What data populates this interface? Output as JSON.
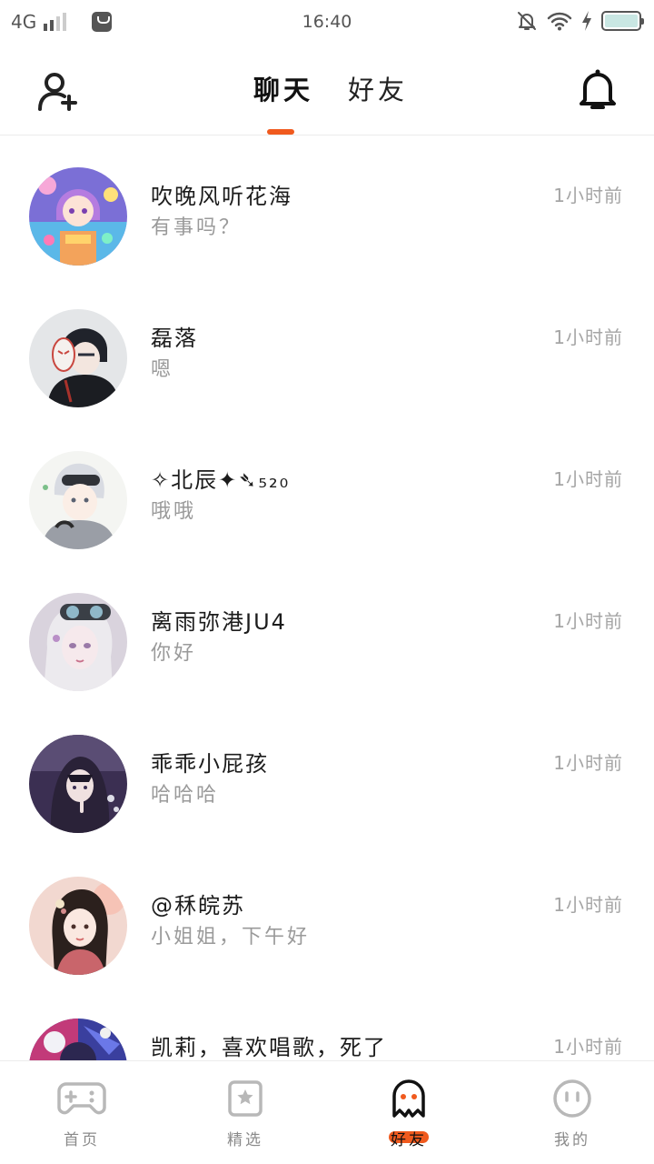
{
  "status_bar": {
    "network": "4G",
    "time": "16:40",
    "icons": [
      "signal-icon",
      "app-notification-icon",
      "mute-bell-icon",
      "wifi-icon",
      "charging-icon",
      "battery-icon"
    ]
  },
  "header": {
    "tabs": [
      {
        "label": "聊天",
        "active": true
      },
      {
        "label": "好友",
        "active": false
      }
    ],
    "accent_color": "#f05a1e"
  },
  "chats": [
    {
      "name": "吹晚风听花海",
      "message": "有事吗？",
      "time": "1小时前",
      "avatar": "avatar-anime-girl-purple"
    },
    {
      "name": "磊落",
      "message": "嗯",
      "time": "1小时前",
      "avatar": "avatar-masked-boy"
    },
    {
      "name": "✧北辰✦➴₅₂₀",
      "message": "哦哦",
      "time": "1小时前",
      "avatar": "avatar-white-hair-boy"
    },
    {
      "name": "离雨弥港JU4",
      "message": "你好",
      "time": "1小时前",
      "avatar": "avatar-goggles-girl"
    },
    {
      "name": "乖乖小屁孩",
      "message": "哈哈哈",
      "time": "1小时前",
      "avatar": "avatar-hooded-boy"
    },
    {
      "name": "@秝皖苏",
      "message": "小姐姐，下午好",
      "time": "1小时前",
      "avatar": "avatar-hanfu-girl"
    },
    {
      "name": "凯莉，喜欢唱歌，死了",
      "message": "",
      "time": "1小时前",
      "avatar": "avatar-colorful-girl"
    }
  ],
  "bottom_nav": [
    {
      "label": "首页",
      "icon": "gamepad-icon",
      "active": false
    },
    {
      "label": "精选",
      "icon": "star-bookmark-icon",
      "active": false
    },
    {
      "label": "好友",
      "icon": "ghost-icon",
      "active": true
    },
    {
      "label": "我的",
      "icon": "face-icon",
      "active": false
    }
  ]
}
